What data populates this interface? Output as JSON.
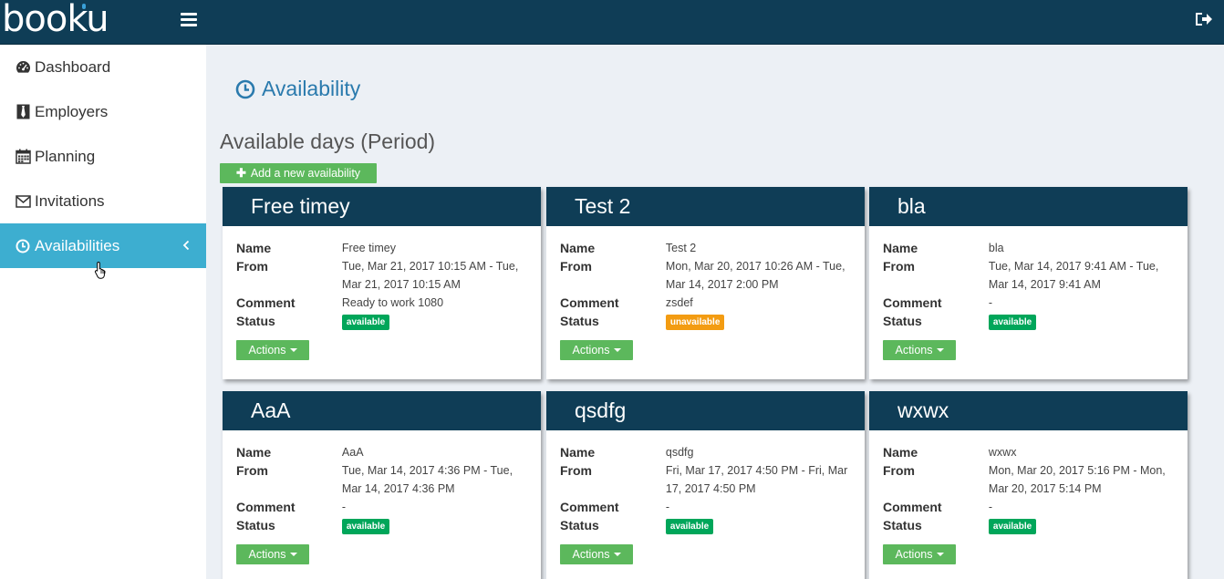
{
  "app": {
    "logo": "booku"
  },
  "sidebar": {
    "items": [
      {
        "label": "Dashboard",
        "icon": "dashboard-icon"
      },
      {
        "label": "Employers",
        "icon": "tie-icon"
      },
      {
        "label": "Planning",
        "icon": "calendar-icon"
      },
      {
        "label": "Invitations",
        "icon": "envelope-icon"
      },
      {
        "label": "Availabilities",
        "icon": "clock-icon",
        "active": true
      }
    ]
  },
  "page": {
    "title": "Availability",
    "section_title": "Available days (Period)",
    "add_button": "Add a new availability"
  },
  "labels": {
    "name": "Name",
    "from": "From",
    "comment": "Comment",
    "status": "Status",
    "actions": "Actions"
  },
  "cards": [
    {
      "title": "Free timey",
      "name": "Free timey",
      "from": "Tue, Mar 21, 2017 10:15 AM - Tue, Mar 21, 2017 10:15 AM",
      "comment": "Ready to work 1080",
      "status": "available"
    },
    {
      "title": "Test 2",
      "name": "Test 2",
      "from": "Mon, Mar 20, 2017 10:26 AM - Tue, Mar 14, 2017 2:00 PM",
      "comment": "zsdef",
      "status": "unavailable"
    },
    {
      "title": "bla",
      "name": "bla",
      "from": "Tue, Mar 14, 2017 9:41 AM - Tue, Mar 14, 2017 9:41 AM",
      "comment": "-",
      "status": "available"
    },
    {
      "title": "AaA",
      "name": "AaA",
      "from": "Tue, Mar 14, 2017 4:36 PM - Tue, Mar 14, 2017 4:36 PM",
      "comment": "-",
      "status": "available"
    },
    {
      "title": "qsdfg",
      "name": "qsdfg",
      "from": "Fri, Mar 17, 2017 4:50 PM - Fri, Mar 17, 2017 4:50 PM",
      "comment": "-",
      "status": "available"
    },
    {
      "title": "wxwx",
      "name": "wxwx",
      "from": "Mon, Mar 20, 2017 5:16 PM - Mon, Mar 20, 2017 5:14 PM",
      "comment": "-",
      "status": "available"
    }
  ],
  "colors": {
    "topbar": "#0f3d56",
    "active_nav": "#3daed0",
    "button": "#5cb85c",
    "available": "#00a65a",
    "unavailable": "#f39c12",
    "title": "#2a7aad"
  }
}
